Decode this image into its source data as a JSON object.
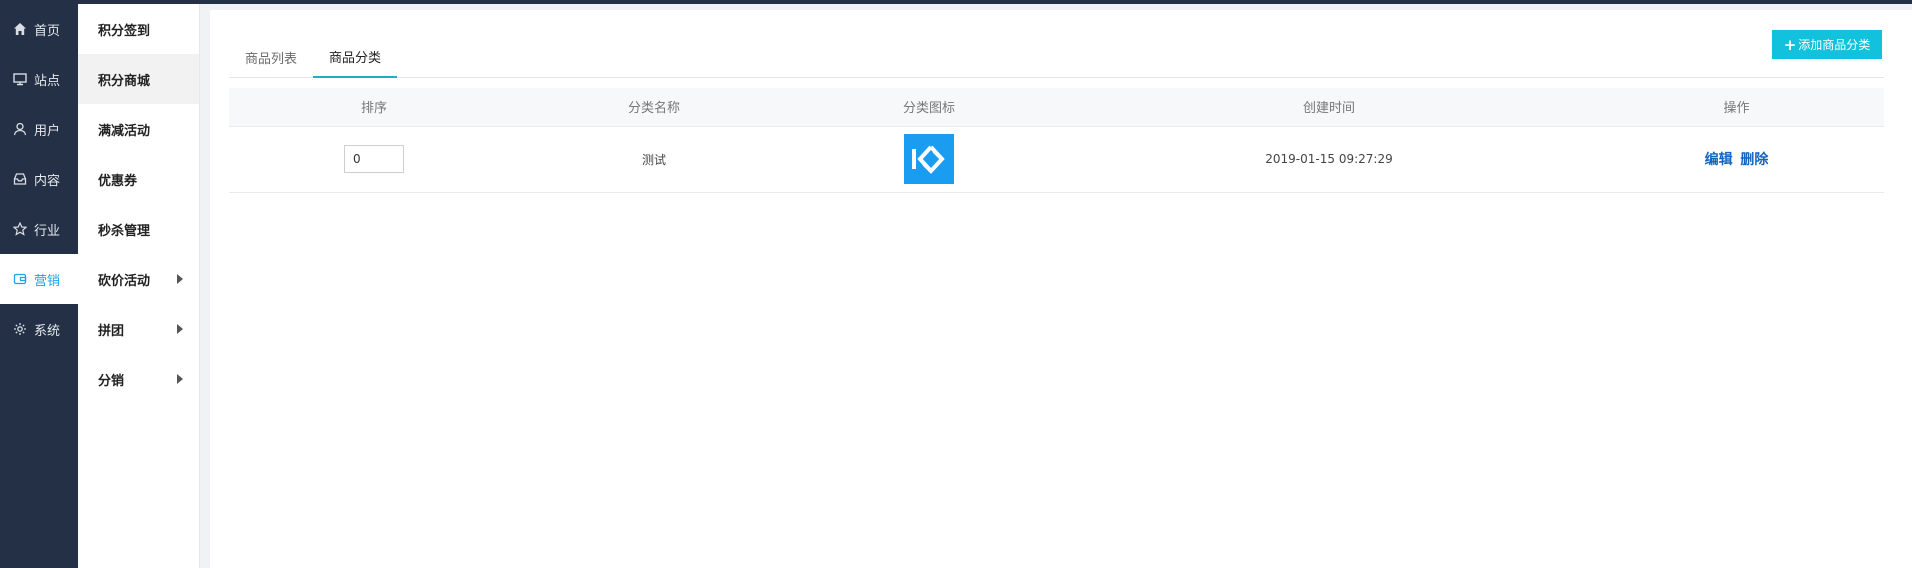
{
  "left_nav": {
    "items": [
      {
        "label": "首页",
        "icon": "home-icon"
      },
      {
        "label": "站点",
        "icon": "monitor-icon"
      },
      {
        "label": "用户",
        "icon": "user-icon"
      },
      {
        "label": "内容",
        "icon": "inbox-icon"
      },
      {
        "label": "行业",
        "icon": "star-icon"
      },
      {
        "label": "营销",
        "icon": "wallet-icon",
        "active": true
      },
      {
        "label": "系统",
        "icon": "gear-icon"
      }
    ]
  },
  "sub_nav": {
    "items": [
      {
        "label": "积分签到"
      },
      {
        "label": "积分商城",
        "active": true
      },
      {
        "label": "满减活动"
      },
      {
        "label": "优惠券"
      },
      {
        "label": "秒杀管理"
      },
      {
        "label": "砍价活动",
        "has_children": true
      },
      {
        "label": "拼团",
        "has_children": true
      },
      {
        "label": "分销",
        "has_children": true
      }
    ]
  },
  "tabs": [
    {
      "label": "商品列表"
    },
    {
      "label": "商品分类",
      "active": true
    }
  ],
  "toolbar": {
    "add_label": "添加商品分类"
  },
  "table": {
    "columns": [
      "排序",
      "分类名称",
      "分类图标",
      "创建时间",
      "操作"
    ],
    "rows": [
      {
        "sort": "0",
        "name": "测试",
        "icon": "category-logo-icon",
        "created": "2019-01-15 09:27:29",
        "edit": "编辑",
        "delete": "删除"
      }
    ]
  },
  "colors": {
    "nav_bg": "#233045",
    "accent": "#12c2dc",
    "link": "#1565c0",
    "icon_bg": "#1a9cf0"
  }
}
